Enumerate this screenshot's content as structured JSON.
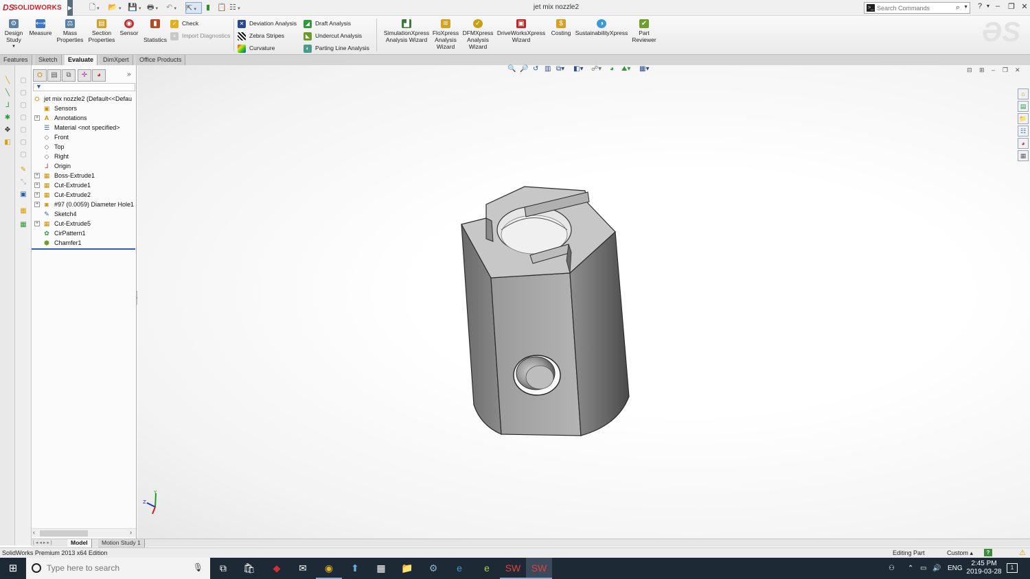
{
  "app": {
    "brand": "SOLIDWORKS",
    "brand_mark": "DS",
    "document_title": "jet mix nozzle2"
  },
  "search": {
    "placeholder": "Search Commands"
  },
  "ribbon": {
    "buttons": {
      "design_study": "Design Study",
      "measure": "Measure",
      "mass_properties": "Mass Properties",
      "section_properties": "Section Properties",
      "sensor": "Sensor",
      "statistics": "Statistics",
      "check": "Check",
      "import_diagnostics": "Import Diagnostics",
      "deviation_analysis": "Deviation Analysis",
      "zebra_stripes": "Zebra Stripes",
      "curvature": "Curvature",
      "draft_analysis": "Draft Analysis",
      "undercut_analysis": "Undercut Analysis",
      "parting_line_analysis": "Parting Line Analysis",
      "simulationxpress": "SimulationXpress Analysis Wizard",
      "floxpress": "FloXpress Analysis Wizard",
      "dfmxpress": "DFMXpress Analysis Wizard",
      "driveworksxpress": "DriveWorksXpress Wizard",
      "costing": "Costing",
      "sustainabilityxpress": "SustainabilityXpress",
      "part_reviewer": "Part Reviewer"
    }
  },
  "tabs": [
    "Features",
    "Sketch",
    "Evaluate",
    "DimXpert",
    "Office Products"
  ],
  "active_tab": "Evaluate",
  "tree": {
    "root": "jet mix nozzle2  (Default<<Defau",
    "items": [
      {
        "label": "Sensors",
        "expandable": false,
        "icon": "sensor-icon"
      },
      {
        "label": "Annotations",
        "expandable": true,
        "icon": "annotation-icon"
      },
      {
        "label": "Material <not specified>",
        "expandable": false,
        "icon": "material-icon"
      },
      {
        "label": "Front",
        "expandable": false,
        "icon": "plane-icon"
      },
      {
        "label": "Top",
        "expandable": false,
        "icon": "plane-icon"
      },
      {
        "label": "Right",
        "expandable": false,
        "icon": "plane-icon"
      },
      {
        "label": "Origin",
        "expandable": false,
        "icon": "origin-icon"
      },
      {
        "label": "Boss-Extrude1",
        "expandable": true,
        "icon": "extrude-icon"
      },
      {
        "label": "Cut-Extrude1",
        "expandable": true,
        "icon": "extrude-icon"
      },
      {
        "label": "Cut-Extrude2",
        "expandable": true,
        "icon": "extrude-icon"
      },
      {
        "label": "#97 (0.0059) Diameter Hole1",
        "expandable": true,
        "icon": "hole-icon"
      },
      {
        "label": "Sketch4",
        "expandable": false,
        "icon": "sketch-icon"
      },
      {
        "label": "Cut-Extrude5",
        "expandable": true,
        "icon": "extrude-icon"
      },
      {
        "label": "CirPattern1",
        "expandable": false,
        "icon": "pattern-icon"
      },
      {
        "label": "Chamfer1",
        "expandable": false,
        "icon": "chamfer-icon"
      }
    ]
  },
  "bottom_tabs": [
    "Model",
    "Motion Study 1"
  ],
  "status": {
    "edition": "SolidWorks Premium 2013 x64 Edition",
    "mode": "Editing Part",
    "units": "Custom"
  },
  "taskbar": {
    "search_placeholder": "Type here to search",
    "language": "ENG",
    "time": "2:45 PM",
    "date": "2019-03-28"
  },
  "colors": {
    "brand_red": "#d4202a",
    "selection_blue": "#2a5cb8",
    "taskbar": "#1d2a35"
  }
}
